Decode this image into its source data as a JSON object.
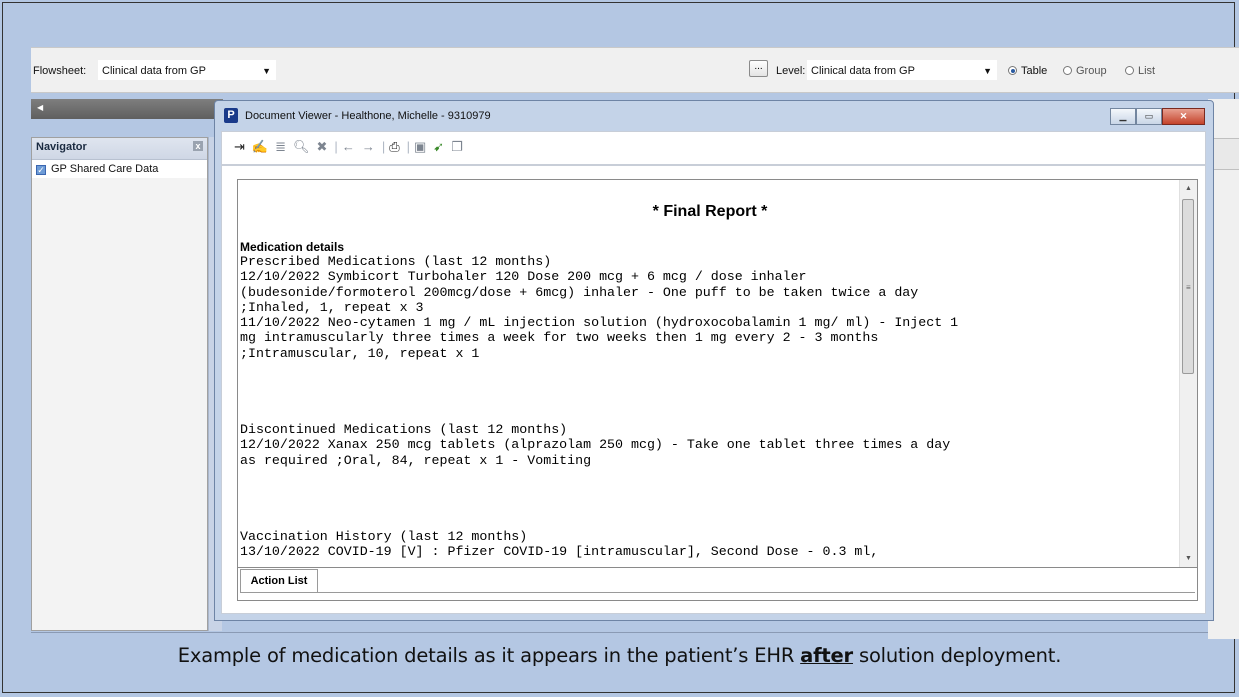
{
  "flowsheet": {
    "label": "Flowsheet:",
    "value": "Clinical data from GP",
    "ellipsis": "...",
    "level_label": "Level:",
    "level_value": "Clinical data from GP",
    "radios": [
      {
        "label": "Table",
        "selected": true
      },
      {
        "label": "Group",
        "selected": false
      },
      {
        "label": "List",
        "selected": false
      }
    ]
  },
  "navigator": {
    "title": "Navigator",
    "close": "x",
    "items": [
      {
        "label": "GP Shared Care Data",
        "checked": true
      }
    ]
  },
  "viewer": {
    "icon": "P",
    "title": "Document Viewer - Healthone, Michelle - 9310979",
    "toolbar_icons": [
      "insert-icon",
      "sign-icon",
      "list-icon",
      "zoom-icon",
      "delete-icon",
      "back-arrow-icon",
      "forward-arrow-icon",
      "print-icon",
      "image-icon",
      "forward-user-icon",
      "copy-icon"
    ],
    "document": {
      "heading": "* Final Report *",
      "section_title": "Medication details",
      "lines_1": [
        "Prescribed Medications (last 12 months)",
        "12/10/2022 Symbicort Turbohaler 120 Dose 200 mcg + 6 mcg / dose inhaler",
        "(budesonide/formoterol 200mcg/dose + 6mcg) inhaler - One puff to be taken twice a day",
        ";Inhaled, 1, repeat x 3",
        "11/10/2022 Neo-cytamen 1 mg / mL injection solution (hydroxocobalamin 1 mg/ ml) - Inject 1",
        "mg intramuscularly three times a week for two weeks then 1 mg every 2 - 3 months",
        ";Intramuscular, 10, repeat x 1"
      ],
      "lines_2": [
        "Discontinued Medications (last 12 months)",
        "12/10/2022 Xanax 250 mcg tablets (alprazolam 250 mcg) - Take one tablet three times a day",
        "as required ;Oral, 84, repeat x 1 - Vomiting"
      ],
      "lines_3": [
        "Vaccination History (last 12 months)",
        "13/10/2022 COVID-19 [V] : Pfizer COVID-19 [intramuscular], Second Dose - 0.3 ml,"
      ]
    },
    "action_tab": "Action List"
  },
  "caption": {
    "before": "Example of medication details as it appears in the patient’s EHR ",
    "emphasis": "after",
    "after": " solution deployment."
  }
}
